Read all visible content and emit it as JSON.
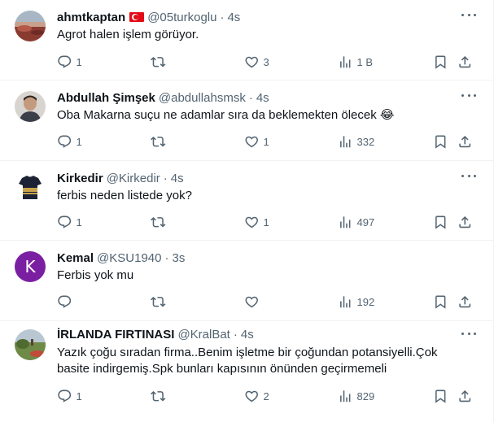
{
  "tweets": [
    {
      "name": "ahmtkaptan",
      "handle": "@05turkoglu",
      "sep": "·",
      "time": "4s",
      "text": "Agrot halen işlem görüyor.",
      "replies": "1",
      "retweets": "",
      "likes": "3",
      "views": "1 B",
      "avatar": "landscape-photo"
    },
    {
      "name": "Abdullah Şimşek",
      "handle": "@abdullahsmsk",
      "sep": "·",
      "time": "4s",
      "text": "Oba Makarna suçu ne adamlar sıra da beklemekten ölecek 😂",
      "replies": "1",
      "retweets": "",
      "likes": "1",
      "views": "332",
      "avatar": "person-photo"
    },
    {
      "name": "Kirkedir",
      "handle": "@Kirkedir",
      "sep": "·",
      "time": "4s",
      "text": "ferbis neden listede yok?",
      "replies": "1",
      "retweets": "",
      "likes": "1",
      "views": "497",
      "avatar": "jersey-image"
    },
    {
      "name": "Kemal",
      "handle": "@KSU1940",
      "sep": "·",
      "time": "3s",
      "text": "Ferbis yok mu",
      "replies": "",
      "retweets": "",
      "likes": "",
      "views": "192",
      "avatar_letter": "K",
      "avatar_color": "#7b1fa2"
    },
    {
      "name": "İRLANDA FIRTINASI",
      "handle": "@KralBat",
      "sep": "·",
      "time": "4s",
      "text_lines": [
        "Yazık çoğu sıradan firma..Benim işletme bir çoğundan potansiyelli.Çok",
        "basite indirgemiş.Spk bunları kapısının önünden geçirmemeli"
      ],
      "replies": "1",
      "retweets": "",
      "likes": "2",
      "views": "829",
      "avatar": "landscape-photo"
    }
  ],
  "icons": {
    "reply": "reply-icon",
    "retweet": "retweet-icon",
    "like": "like-icon",
    "views": "views-icon",
    "bookmark": "bookmark-icon",
    "share": "share-icon",
    "more": "more-icon",
    "flag": "turkey-flag-icon"
  },
  "colors": {
    "text": "#0f1419",
    "secondary": "#536471",
    "divider": "#eff3f4"
  }
}
